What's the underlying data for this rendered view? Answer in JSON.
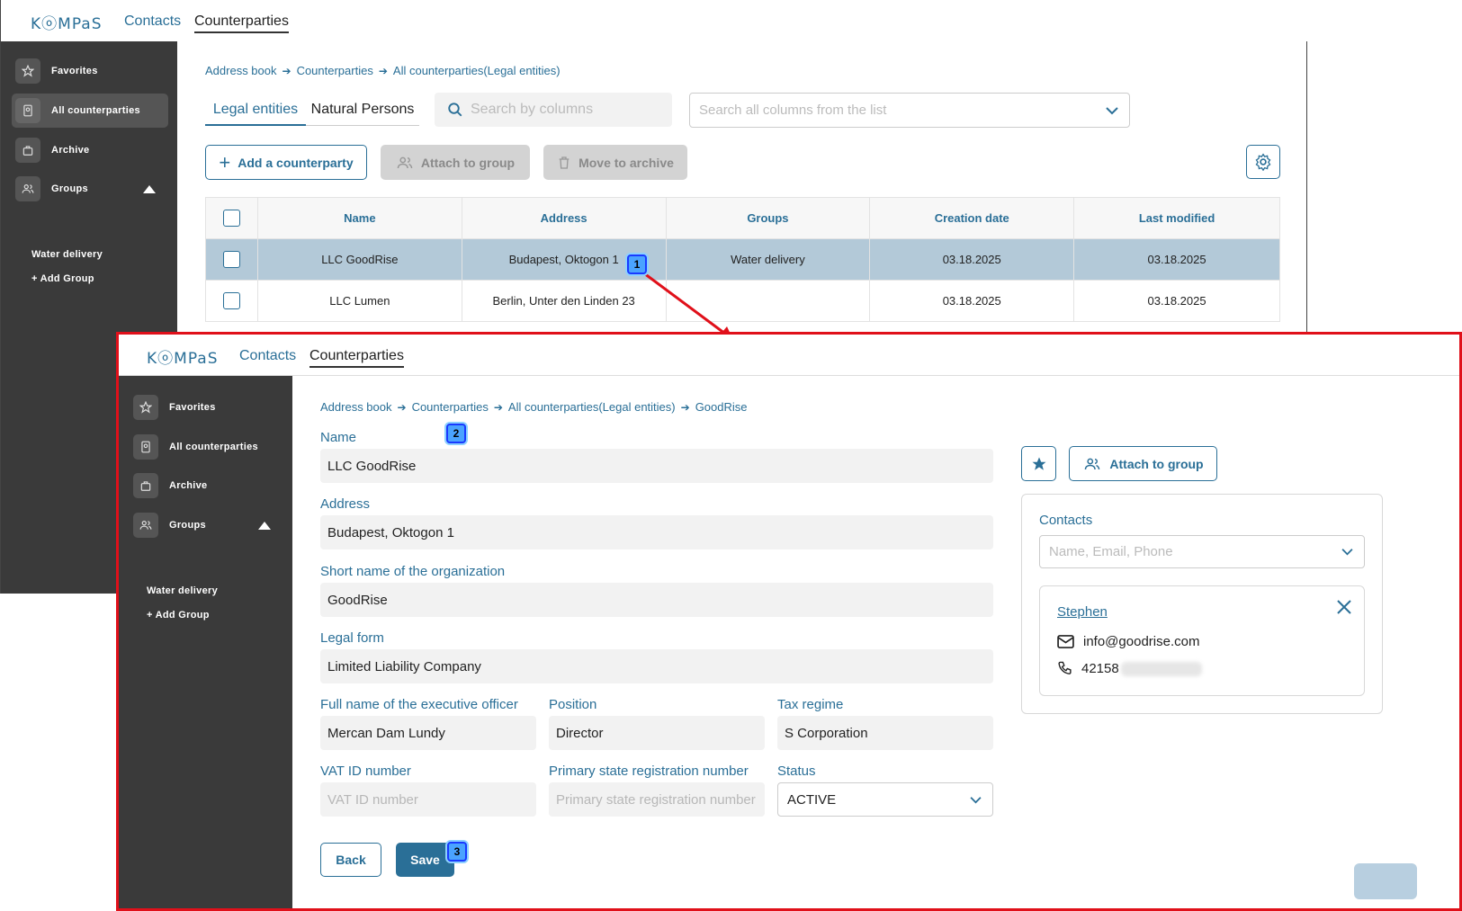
{
  "app": {
    "logo": "KⓞMPaS",
    "nav": {
      "contacts": "Contacts",
      "counterparties": "Counterparties"
    }
  },
  "sidebar": {
    "favorites": "Favorites",
    "all_counterparties": "All counterparties",
    "archive": "Archive",
    "groups": "Groups",
    "group_item": "Water delivery",
    "add_group": "+ Add Group"
  },
  "list_view": {
    "breadcrumb": [
      "Address book",
      "Counterparties",
      "All counterparties(Legal entities)"
    ],
    "tabs": {
      "legal": "Legal entities",
      "natural": "Natural Persons"
    },
    "search": {
      "placeholder": "Search by columns"
    },
    "search_all": {
      "placeholder": "Search all columns from the list"
    },
    "buttons": {
      "add": "Add a counterparty",
      "attach": "Attach to group",
      "archive": "Move to archive"
    },
    "table": {
      "columns": [
        "Name",
        "Address",
        "Groups",
        "Creation date",
        "Last modified"
      ],
      "rows": [
        {
          "name": "LLC GoodRise",
          "address": "Budapest, Oktogon 1",
          "groups": "Water delivery",
          "created": "03.18.2025",
          "modified": "03.18.2025"
        },
        {
          "name": "LLC Lumen",
          "address": "Berlin, Unter den Linden 23",
          "groups": "",
          "created": "03.18.2025",
          "modified": "03.18.2025"
        }
      ]
    }
  },
  "detail_view": {
    "breadcrumb": [
      "Address book",
      "Counterparties",
      "All counterparties(Legal entities)",
      "GoodRise"
    ],
    "fields": {
      "name": {
        "label": "Name",
        "value": "LLC GoodRise"
      },
      "address": {
        "label": "Address",
        "value": "Budapest, Oktogon 1"
      },
      "short_name": {
        "label": "Short name of the organization",
        "value": "GoodRise"
      },
      "legal_form": {
        "label": "Legal form",
        "value": "Limited Liability Company"
      },
      "executive": {
        "label": "Full name of the executive officer",
        "value": "Mercan Dam Lundy"
      },
      "position": {
        "label": "Position",
        "value": "Director"
      },
      "tax_regime": {
        "label": "Tax regime",
        "value": "S Corporation"
      },
      "vat": {
        "label": "VAT ID number",
        "placeholder": "VAT ID number"
      },
      "psrn": {
        "label": "Primary state registration number",
        "placeholder": "Primary state registration number"
      },
      "status": {
        "label": "Status",
        "value": "ACTIVE"
      }
    },
    "buttons": {
      "back": "Back",
      "save": "Save",
      "attach": "Attach to group"
    },
    "contacts": {
      "label": "Contacts",
      "placeholder": "Name, Email, Phone",
      "card": {
        "name": "Stephen",
        "email": "info@goodrise.com",
        "phone": "42158"
      }
    }
  },
  "annotations": {
    "badge1": "1",
    "badge2": "2",
    "badge3": "3"
  },
  "colors": {
    "accent": "#2a6f97",
    "sidebar": "#3a3a3a",
    "selected_row": "#b3c9d8",
    "highlight_frame": "#e0101a"
  }
}
